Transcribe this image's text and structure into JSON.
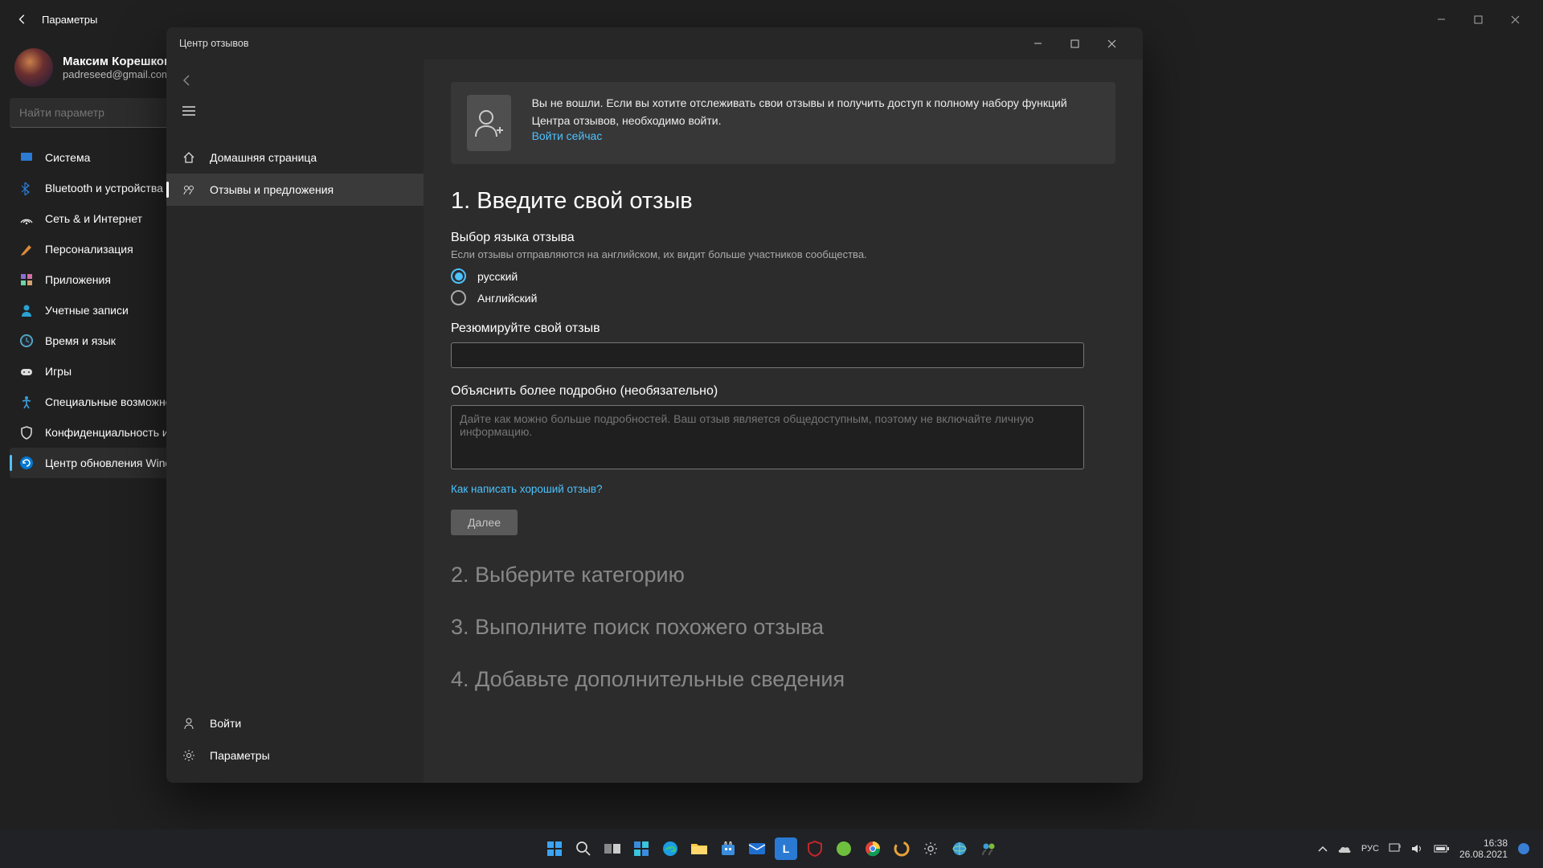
{
  "settings": {
    "title": "Параметры",
    "user_name": "Максим Корешков",
    "user_email": "padreseed@gmail.com",
    "search_placeholder": "Найти параметр",
    "nav": [
      {
        "label": "Система",
        "icon": "system"
      },
      {
        "label": "Bluetooth и устройства",
        "icon": "bt"
      },
      {
        "label": "Сеть & и Интернет",
        "icon": "net"
      },
      {
        "label": "Персонализация",
        "icon": "pers"
      },
      {
        "label": "Приложения",
        "icon": "apps"
      },
      {
        "label": "Учетные записи",
        "icon": "acc"
      },
      {
        "label": "Время и язык",
        "icon": "time"
      },
      {
        "label": "Игры",
        "icon": "games"
      },
      {
        "label": "Специальные возможности",
        "icon": "access"
      },
      {
        "label": "Конфиденциальность и защита",
        "icon": "priv"
      },
      {
        "label": "Центр обновления Windows",
        "icon": "update",
        "active": true
      }
    ]
  },
  "fh": {
    "title": "Центр отзывов",
    "nav_home": "Домашняя страница",
    "nav_feedback": "Отзывы и предложения",
    "nav_signin": "Войти",
    "nav_settings": "Параметры",
    "banner_text": "Вы не вошли. Если вы хотите отслеживать свои отзывы и получить доступ к полному набору функций Центра отзывов, необходимо войти.",
    "banner_link": "Войти сейчас",
    "step1_title": "1. Введите свой отзыв",
    "lang_label": "Выбор языка отзыва",
    "lang_hint": "Если отзывы отправляются на английском, их видит больше участников сообщества.",
    "lang_ru": "русский",
    "lang_en": "Английский",
    "summary_label": "Резюмируйте свой отзыв",
    "detail_label": "Объяснить более подробно (необязательно)",
    "detail_placeholder": "Дайте как можно больше подробностей. Ваш отзыв является общедоступным, поэтому не включайте личную информацию.",
    "help_link": "Как написать хороший отзыв?",
    "next_btn": "Далее",
    "step2_title": "2. Выберите категорию",
    "step3_title": "3. Выполните поиск похожего отзыва",
    "step4_title": "4. Добавьте дополнительные сведения"
  },
  "tray": {
    "lang": "РУС",
    "time": "16:38",
    "date": "26.08.2021"
  }
}
